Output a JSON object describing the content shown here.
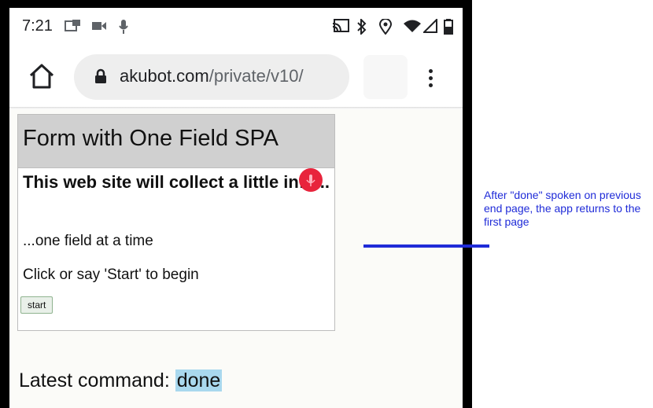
{
  "status_bar": {
    "time": "7:21",
    "left_icons": [
      "notification-icon",
      "video-camera-icon",
      "microphone-icon"
    ],
    "right_icons": [
      "cast-icon",
      "bluetooth-icon",
      "location-icon",
      "wifi-icon",
      "signal-icon",
      "battery-icon"
    ]
  },
  "browser": {
    "url_domain": "akubot.com",
    "url_path": "/private/v10/"
  },
  "app": {
    "title": "Form with One Field SPA",
    "intro_heading": "This web site will collect a little info...",
    "line1": "...one field at a time",
    "line2": "Click or say 'Start' to begin",
    "start_label": "start",
    "mic_color": "#e8243c"
  },
  "latest_command": {
    "label": "Latest command:",
    "value": "done"
  },
  "annotation": {
    "text": "After \"done\" spoken on previous end page, the app returns to the first page",
    "color": "#1f2bd8"
  }
}
